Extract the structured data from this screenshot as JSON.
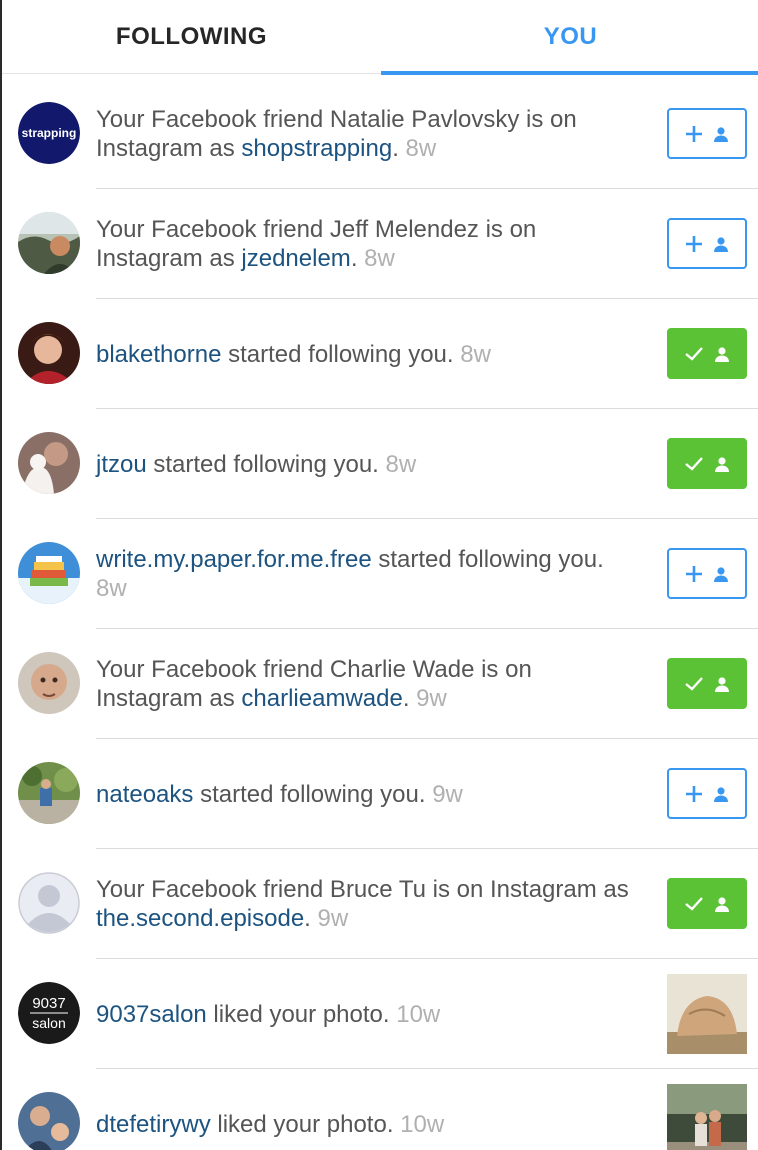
{
  "tabs": {
    "following": "FOLLOWING",
    "you": "YOU"
  },
  "colors": {
    "accent": "#3897f0",
    "username": "#1c5380",
    "follow_green": "#5bc236",
    "body_text": "#555555",
    "time_text": "#b0b0b0"
  },
  "rows": [
    {
      "avatar_text": "strapping",
      "pre": "Your Facebook friend Natalie Pavlovsky is on Instagram as ",
      "username": "shopstrapping",
      "post": ".",
      "time": "8w",
      "action": "follow"
    },
    {
      "pre": "Your Facebook friend Jeff Melendez is on Instagram as ",
      "username": "jzednelem",
      "post": ".",
      "time": "8w",
      "action": "follow"
    },
    {
      "pre": "",
      "username": "blakethorne",
      "post": " started following you.",
      "time": "8w",
      "action": "following"
    },
    {
      "pre": "",
      "username": "jtzou",
      "post": " started following you.",
      "time": "8w",
      "action": "following"
    },
    {
      "pre": "",
      "username": "write.my.paper.for.me.free",
      "post": " started following you.",
      "time": "8w",
      "action": "follow"
    },
    {
      "pre": "Your Facebook friend Charlie Wade is on Instagram as ",
      "username": "charlieamwade",
      "post": ".",
      "time": "9w",
      "action": "following"
    },
    {
      "pre": "",
      "username": "nateoaks",
      "post": " started following you.",
      "time": "9w",
      "action": "follow"
    },
    {
      "pre": "Your Facebook friend Bruce Tu is on Instagram as ",
      "username": "the.second.episode",
      "post": ".",
      "time": "9w",
      "action": "following"
    },
    {
      "avatar_text_top": "9037",
      "avatar_text_bottom": "salon",
      "pre": "",
      "username": "9037salon",
      "post": " liked your photo.",
      "time": "10w",
      "action": "photo"
    },
    {
      "pre": "",
      "username": "dtefetirywy",
      "post": " liked your photo.",
      "time": "10w",
      "action": "photo"
    }
  ]
}
